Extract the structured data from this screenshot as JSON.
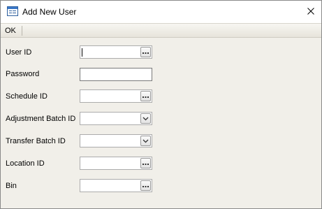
{
  "window": {
    "title": "Add New User"
  },
  "toolbar": {
    "ok_label": "OK"
  },
  "fields": [
    {
      "label": "User ID",
      "value": "",
      "type": "ellipsis",
      "focused": true
    },
    {
      "label": "Password",
      "value": "",
      "type": "text"
    },
    {
      "label": "Schedule ID",
      "value": "",
      "type": "ellipsis"
    },
    {
      "label": "Adjustment Batch ID",
      "value": "",
      "type": "dropdown"
    },
    {
      "label": "Transfer Batch ID",
      "value": "",
      "type": "dropdown"
    },
    {
      "label": "Location ID",
      "value": "",
      "type": "ellipsis"
    },
    {
      "label": "Bin",
      "value": "",
      "type": "ellipsis"
    }
  ]
}
